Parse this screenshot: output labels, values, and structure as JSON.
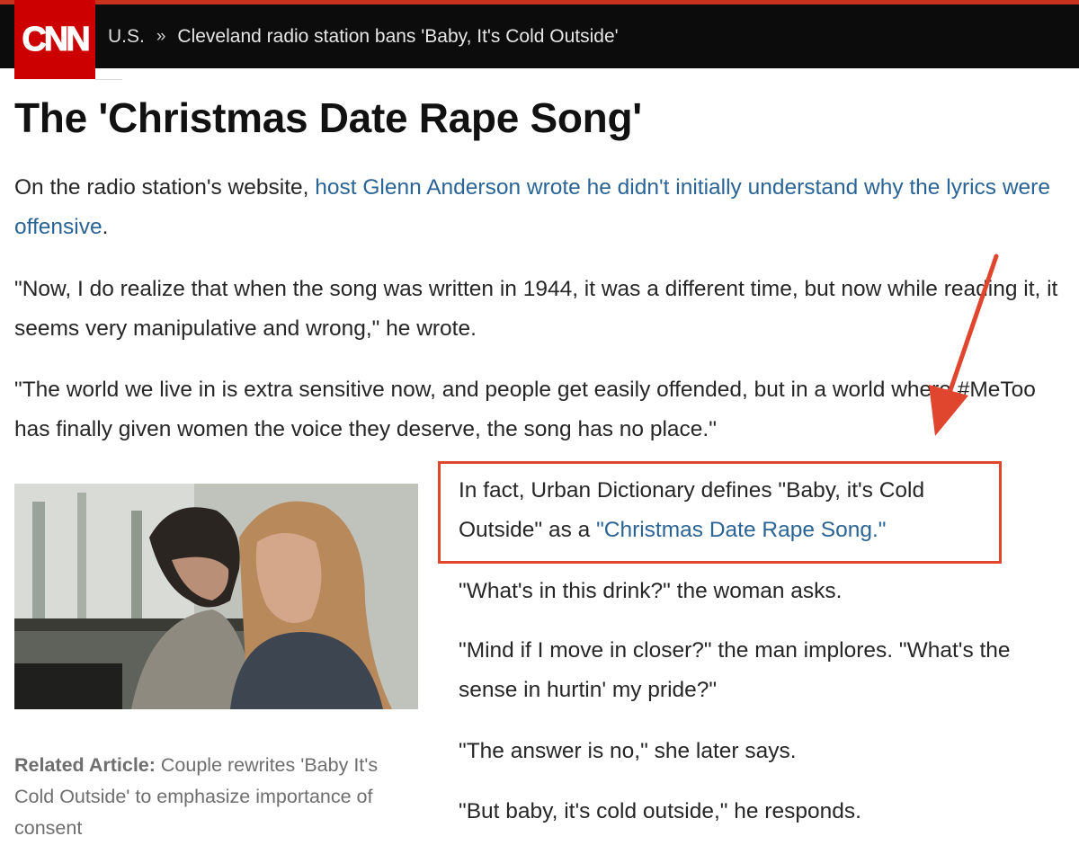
{
  "header": {
    "logo": "CNN",
    "breadcrumb": {
      "section": "U.S.",
      "separator": "»",
      "current": "Cleveland radio station bans 'Baby, It's Cold Outside'"
    },
    "accent_color": "#c9311f"
  },
  "article": {
    "headline": "The 'Christmas Date Rape Song'",
    "p1": {
      "lead": "On the radio station's website, ",
      "link": "host Glenn Anderson wrote he didn't initially understand why the lyrics were offensive",
      "tail": "."
    },
    "p2": "\"Now, I do realize that when the song was written in 1944, it was a different time, but now while reading it, it seems very manipulative and wrong,\" he wrote.",
    "p3": "\"The world we live in is extra sensitive now, and people get easily offended, but in a world where #MeToo has finally given women the voice they deserve, the song has no place.\"",
    "highlight": {
      "lead": "In fact, Urban Dictionary defines \"Baby, it's Cold Outside\" as a ",
      "link": "\"Christmas Date Rape Song.\""
    },
    "q1": "\"What's in this drink?\" the woman asks.",
    "q2": "\"Mind if I move in closer?\" the man implores. \"What's the sense in hurtin' my pride?\"",
    "q3": "\"The answer is no,\" she later says.",
    "q4": "\"But baby, it's cold outside,\" he responds.",
    "related": {
      "label": "Related Article:",
      "text": " Couple rewrites 'Baby It's Cold Outside' to emphasize importance of consent"
    }
  },
  "colors": {
    "link": "#2a6496",
    "highlight_border": "#e0452e",
    "arrow": "#e0452e",
    "cnn_red": "#cc0000"
  }
}
